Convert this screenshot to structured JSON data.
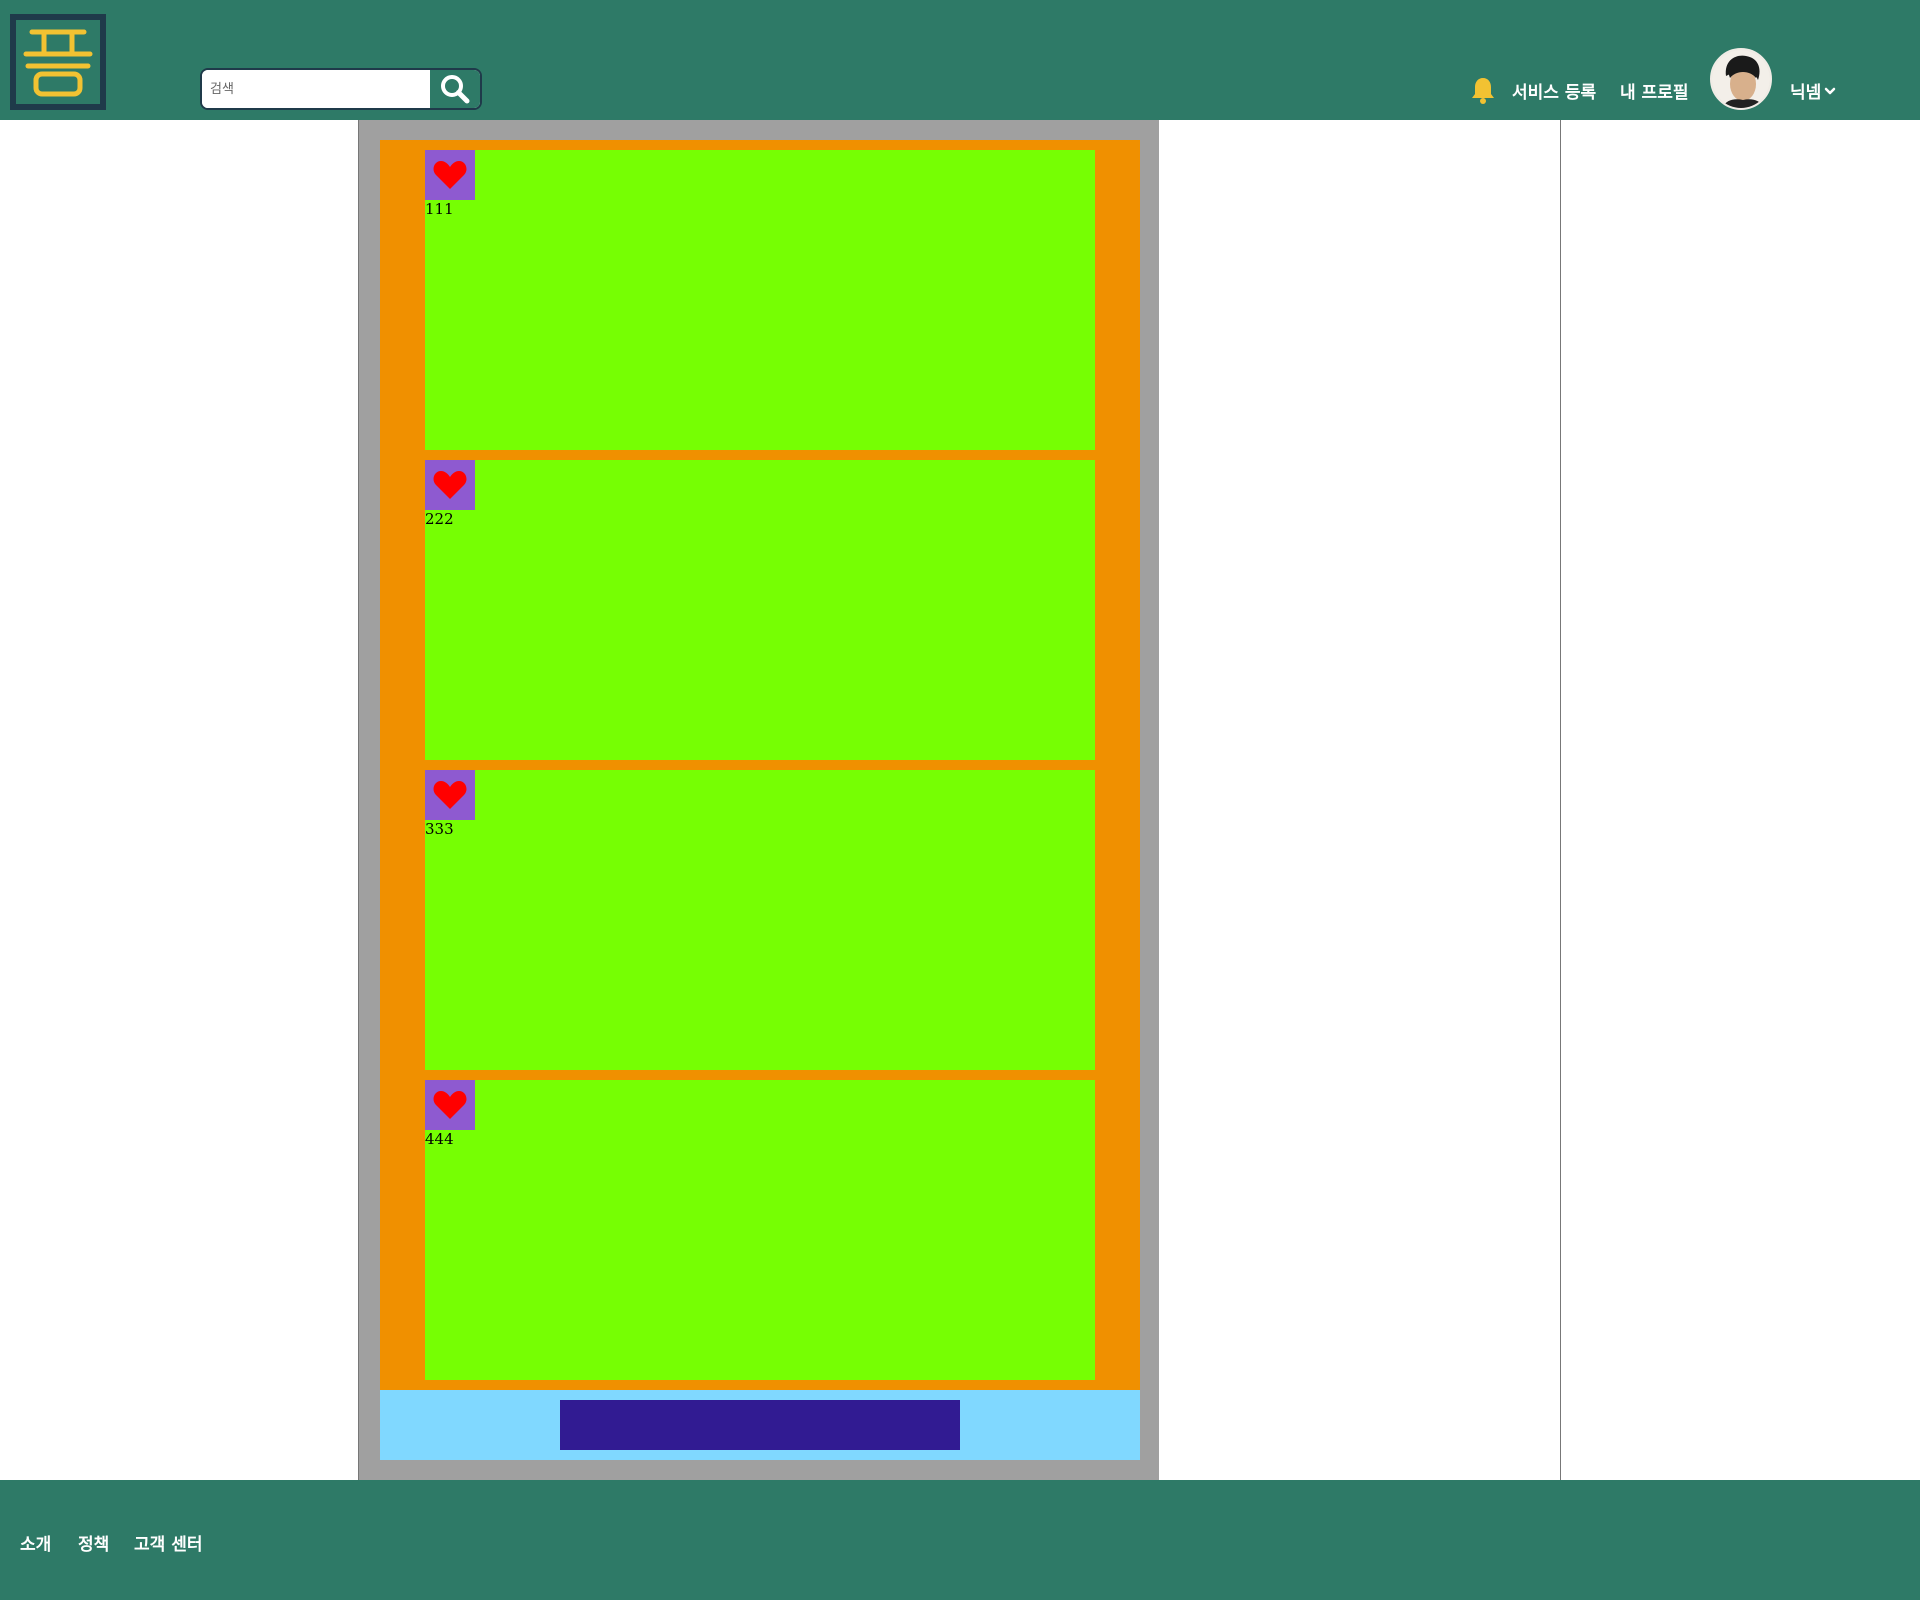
{
  "header": {
    "search": {
      "placeholder": "검색",
      "value": ""
    },
    "nav": {
      "service_register": "서비스 등록",
      "my_profile": "내 프로필",
      "nickname": "닉넴"
    }
  },
  "feed": {
    "cards": [
      {
        "likes": "111"
      },
      {
        "likes": "222"
      },
      {
        "likes": "333"
      },
      {
        "likes": "444"
      }
    ]
  },
  "footer": {
    "links": [
      "소개",
      "정책",
      "고객 센터"
    ]
  },
  "colors": {
    "header_bg": "#2e7a67",
    "logo_frame": "#1f3a4a",
    "logo_glyph": "#f2c232",
    "column_bg": "#a0a0a0",
    "feed_bg": "#f09000",
    "card_bg": "#76ff03",
    "like_bg": "#8e5ad0",
    "heart": "#ff0000",
    "bottom_bar": "#80d8ff",
    "bottom_button": "#311b92",
    "bell": "#f2c232"
  },
  "icons": {
    "logo": "logo-icon",
    "search": "search-icon",
    "bell": "bell-icon",
    "heart": "heart-icon",
    "chevron": "chevron-down-icon"
  }
}
